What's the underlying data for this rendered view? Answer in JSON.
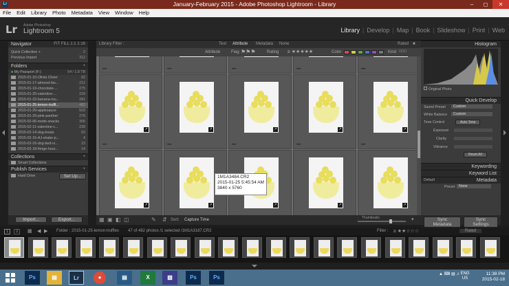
{
  "window": {
    "title": "January-February 2015 - Adobe Photoshop Lightroom - Library",
    "icon": "Lr"
  },
  "menu": [
    "File",
    "Edit",
    "Library",
    "Photo",
    "Metadata",
    "View",
    "Window",
    "Help"
  ],
  "identity": {
    "logo": "Lr",
    "brand_small": "Adobe Photoshop",
    "brand": "Lightroom 5"
  },
  "modules": [
    "Library",
    "Develop",
    "Map",
    "Book",
    "Slideshow",
    "Print",
    "Web"
  ],
  "left": {
    "navigator": {
      "title": "Navigator",
      "options": "FIT  FILL  1:1  1:16"
    },
    "catalog": [
      {
        "name": "Quick Collection +",
        "count": "2"
      },
      {
        "name": "Previous Import",
        "count": "312"
      }
    ],
    "folders_title": "Folders",
    "drive": {
      "name": "My Passport (F:)",
      "info": "54 / 1.8 TB"
    },
    "folders": [
      {
        "name": "2015-01-10-Olivia Cheer",
        "count": "92"
      },
      {
        "name": "2015-01-17-almond-bis...",
        "count": "212"
      },
      {
        "name": "2015-01-19-chocolate-...",
        "count": "275"
      },
      {
        "name": "2015-01-20-valentine-...",
        "count": "159"
      },
      {
        "name": "2015-01-23-banana-mu...",
        "count": "281"
      },
      {
        "name": "2015-01-25-lemon-truffl...",
        "count": "482"
      },
      {
        "name": "2015-01-29-applesauce",
        "count": "503"
      },
      {
        "name": "2015-01-29-pink-panther",
        "count": "276"
      },
      {
        "name": "2015-02-06-motts-snacks",
        "count": "306"
      },
      {
        "name": "2015-02-11-valentine-c...",
        "count": "239"
      },
      {
        "name": "2015-02-14-dog-treats",
        "count": "63"
      },
      {
        "name": "2015-02-15-AJ-shake-p...",
        "count": "4"
      },
      {
        "name": "2015-02-16-dog-bed-vi...",
        "count": "23"
      },
      {
        "name": "2015-02-18-fringe-hour...",
        "count": "14"
      }
    ],
    "collections_title": "Collections",
    "smart_collections": "Smart Collections",
    "publish_title": "Publish Services",
    "hard_drive": "Hard Drive",
    "setup": "Set Up...",
    "import_label": "Import...",
    "export_label": "Export..."
  },
  "filter": {
    "title": "Library Filter :",
    "tabs": [
      "Text",
      "Attribute",
      "Metadata",
      "None"
    ],
    "preset": "Rated"
  },
  "attribute": {
    "label": "Attribute",
    "flag": "Flag",
    "rating": "Rating",
    "color": "Color",
    "kind": "Kind",
    "colors": [
      "#d24b4b",
      "#d4c84a",
      "#57a84e",
      "#4b74c9",
      "#8e52b8",
      "#777777"
    ]
  },
  "tooltip": {
    "filename": "1M1A3484.CR2",
    "datetime": "2015-01-25 5:45:54 AM",
    "dimensions": "3840 x 5760"
  },
  "toolbar": {
    "sort_label": "Sort:",
    "sort_value": "Capture Time",
    "thumbnails": "Thumbnails"
  },
  "filmstrip": {
    "pages": [
      "1",
      "2"
    ],
    "breadcrumb": "Folder : 2015-01-25-lemon-truffles",
    "count": "47 of 482 photos /1 selected /1M1A3187.CR2",
    "filter_label": "Filter :",
    "filter_value": "Rated"
  },
  "right": {
    "histogram": "Histogram",
    "original_photo": "Original Photo",
    "quick_develop": "Quick Develop",
    "saved_preset_label": "Saved Preset",
    "saved_preset_value": "Custom",
    "white_balance_label": "White Balance",
    "white_balance_value": "Custom",
    "tone_control_label": "Tone Control",
    "auto_tone": "Auto Tone",
    "exposure": "Exposure",
    "clarity": "Clarity",
    "vibrance": "Vibrance",
    "reset_all": "Reset All",
    "keywording": "Keywording",
    "keyword_list": "Keyword List",
    "metadata": "Metadata",
    "meta_default": "Default",
    "preset_label": "Preset",
    "preset_value": "None",
    "sync_metadata": "Sync Metadata",
    "sync_settings": "Sync Settings"
  },
  "taskbar": {
    "lang": "ENG",
    "region": "US",
    "time": "11:38 PM",
    "date": "2015-02-18"
  }
}
